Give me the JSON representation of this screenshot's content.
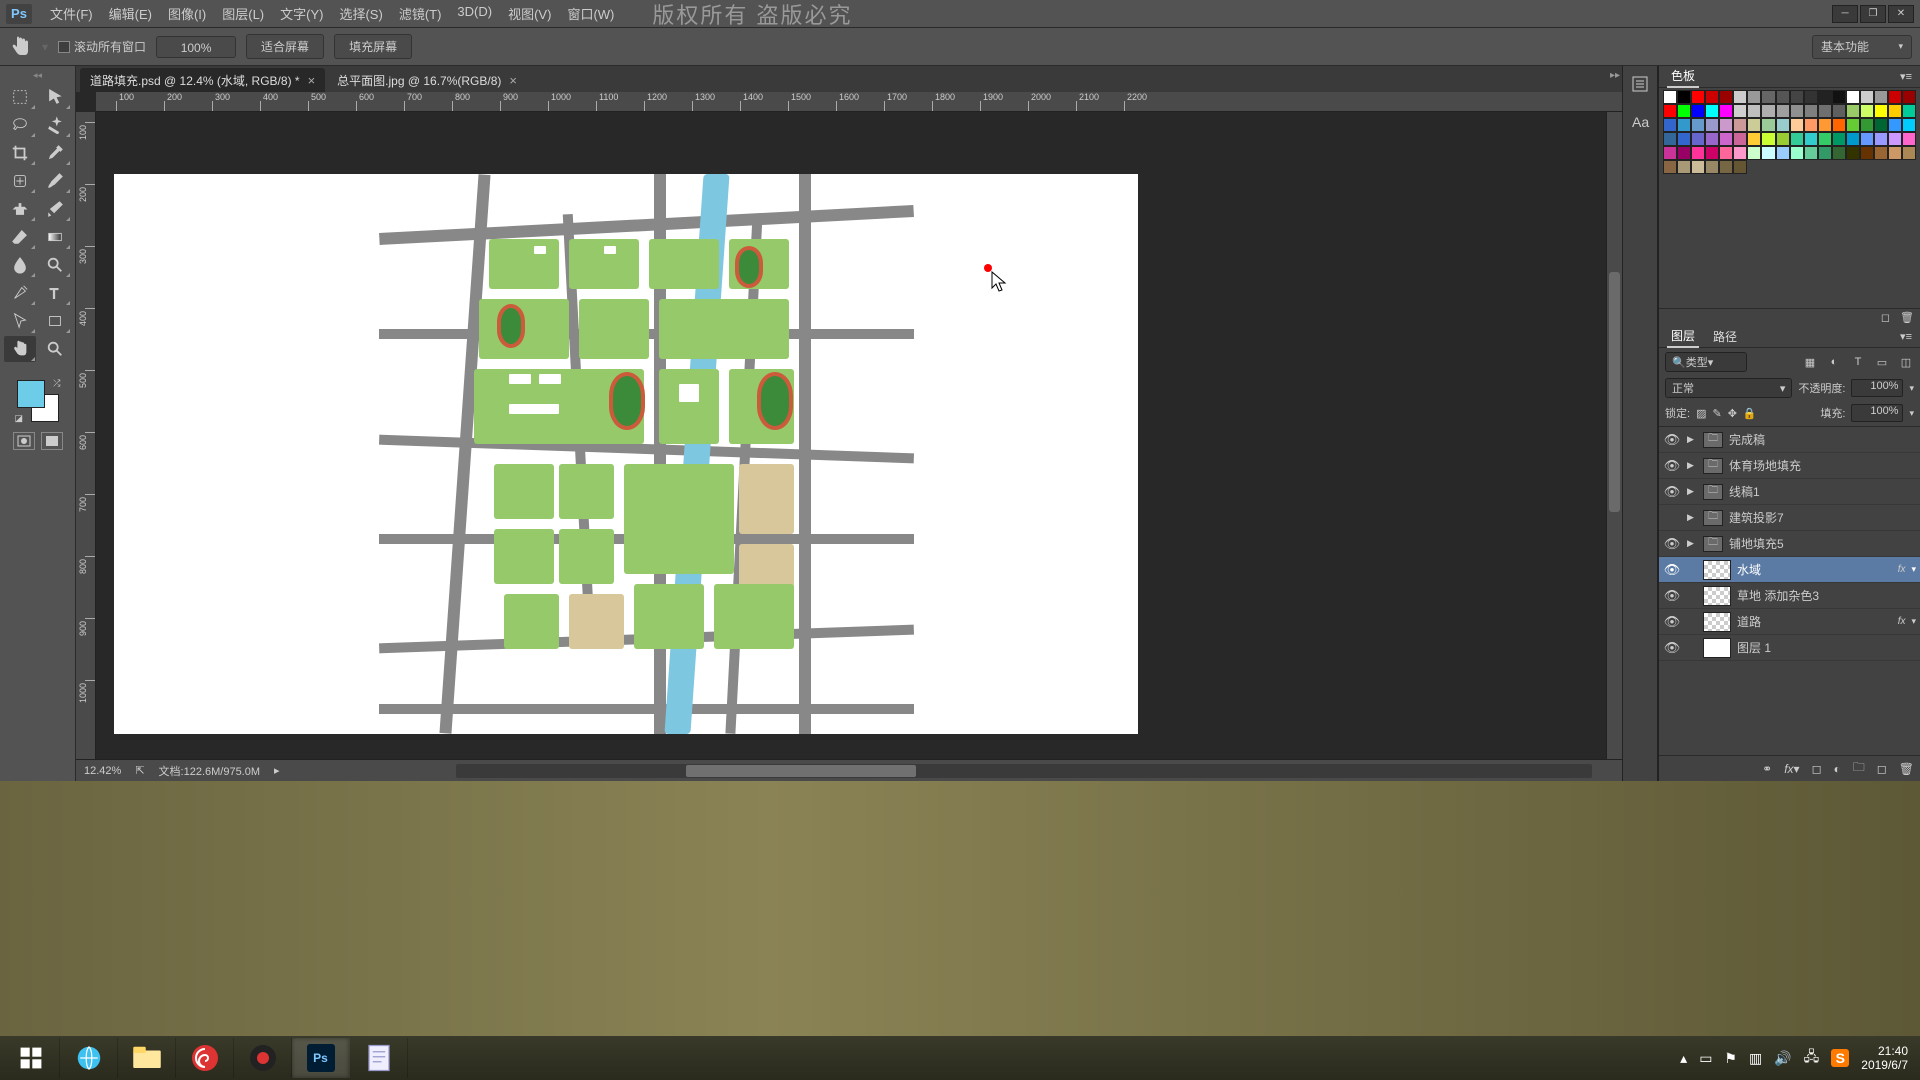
{
  "menubar": {
    "logo": "Ps",
    "items": [
      "文件(F)",
      "编辑(E)",
      "图像(I)",
      "图层(L)",
      "文字(Y)",
      "选择(S)",
      "滤镜(T)",
      "3D(D)",
      "视图(V)",
      "窗口(W)"
    ],
    "watermark": "版权所有 盗版必究"
  },
  "options": {
    "scroll_all_label": "滚动所有窗口",
    "zoom": "100%",
    "fit_screen": "适合屏幕",
    "fill_screen": "填充屏幕",
    "workspace": "基本功能"
  },
  "tabs": [
    {
      "title": "道路填充.psd @ 12.4% (水域, RGB/8) *",
      "active": true
    },
    {
      "title": "总平面图.jpg @ 16.7%(RGB/8)",
      "active": false
    }
  ],
  "ruler_h": [
    "100",
    "200",
    "300",
    "400",
    "500",
    "600",
    "700",
    "800",
    "900",
    "1000",
    "1100",
    "1200",
    "1300",
    "1400",
    "1500",
    "1600",
    "1700",
    "1800",
    "1900",
    "2000",
    "2100",
    "2200"
  ],
  "ruler_v": [
    "100",
    "0",
    "0",
    "0",
    "0",
    "0",
    "0",
    "0",
    "0",
    "0",
    "0",
    "0",
    "0",
    "0",
    "0",
    "0",
    "0",
    "0",
    "0",
    "0",
    "0"
  ],
  "ruler_v_full": [
    "100",
    "200",
    "300",
    "400",
    "500",
    "600",
    "700",
    "800",
    "900",
    "1000"
  ],
  "status": {
    "zoom": "12.42%",
    "doc": "文档:122.6M/975.0M"
  },
  "swatches_panel": {
    "title": "色板"
  },
  "swatch_colors": [
    "#ffffff",
    "#000000",
    "#ff0000",
    "#cc0000",
    "#990000",
    "#cccccc",
    "#999999",
    "#666666",
    "#555555",
    "#444444",
    "#333333",
    "#222222",
    "#111111",
    "#ffffff",
    "#cccccc",
    "#999999",
    "#cc0000",
    "#990000",
    "#ff0000",
    "#00ff00",
    "#0000ff",
    "#00ffff",
    "#ff00ff",
    "#cfcfcf",
    "#bfbfbf",
    "#afafaf",
    "#9f9f9f",
    "#8f8f8f",
    "#7f7f7f",
    "#6f6f6f",
    "#5f5f5f",
    "#99cc66",
    "#ccff66",
    "#ffff00",
    "#ffcc00",
    "#00cc99",
    "#3366cc",
    "#3399cc",
    "#6699cc",
    "#9999cc",
    "#cc99cc",
    "#cc9999",
    "#cccc99",
    "#99cc99",
    "#99cccc",
    "#ffcc99",
    "#ff9966",
    "#ff9933",
    "#ff6600",
    "#66cc33",
    "#339933",
    "#006633",
    "#3399ff",
    "#00ccff",
    "#336699",
    "#3366cc",
    "#6666cc",
    "#9966cc",
    "#cc66cc",
    "#cc6699",
    "#ffcc33",
    "#ccff33",
    "#99cc33",
    "#33cc99",
    "#33cccc",
    "#33cc66",
    "#009966",
    "#0099cc",
    "#6699ff",
    "#9999ff",
    "#cc99ff",
    "#ff66cc",
    "#cc3399",
    "#990066",
    "#ff3399",
    "#cc0066",
    "#ff6699",
    "#ff99cc",
    "#ccffcc",
    "#ccffff",
    "#99ccff",
    "#99ffcc",
    "#66cc99",
    "#339966",
    "#336633",
    "#333300",
    "#663300",
    "#996633",
    "#cc9966",
    "#aa8855",
    "#886644",
    "#aa9977",
    "#ccbb99",
    "#998866",
    "#776644",
    "#665533"
  ],
  "layers_panel": {
    "tabs": [
      "图层",
      "路径"
    ],
    "filter_label": "类型",
    "blend_mode": "正常",
    "opacity_label": "不透明度:",
    "opacity_val": "100%",
    "lock_label": "锁定:",
    "fill_label": "填充:",
    "fill_val": "100%"
  },
  "layers": [
    {
      "name": "完成稿",
      "type": "group",
      "visible": true
    },
    {
      "name": "体育场地填充",
      "type": "group",
      "visible": true
    },
    {
      "name": "线稿1",
      "type": "group",
      "visible": true
    },
    {
      "name": "建筑投影7",
      "type": "group",
      "visible": false
    },
    {
      "name": "铺地填充5",
      "type": "group",
      "visible": true
    },
    {
      "name": "水域",
      "type": "layer",
      "visible": true,
      "selected": true,
      "fx": true
    },
    {
      "name": "草地 添加杂色3",
      "type": "layer",
      "visible": true
    },
    {
      "name": "道路",
      "type": "layer",
      "visible": true,
      "fx": true
    },
    {
      "name": "图层 1",
      "type": "layer",
      "visible": true,
      "white": true
    }
  ],
  "clock": {
    "time": "21:40",
    "date": "2019/6/7"
  }
}
